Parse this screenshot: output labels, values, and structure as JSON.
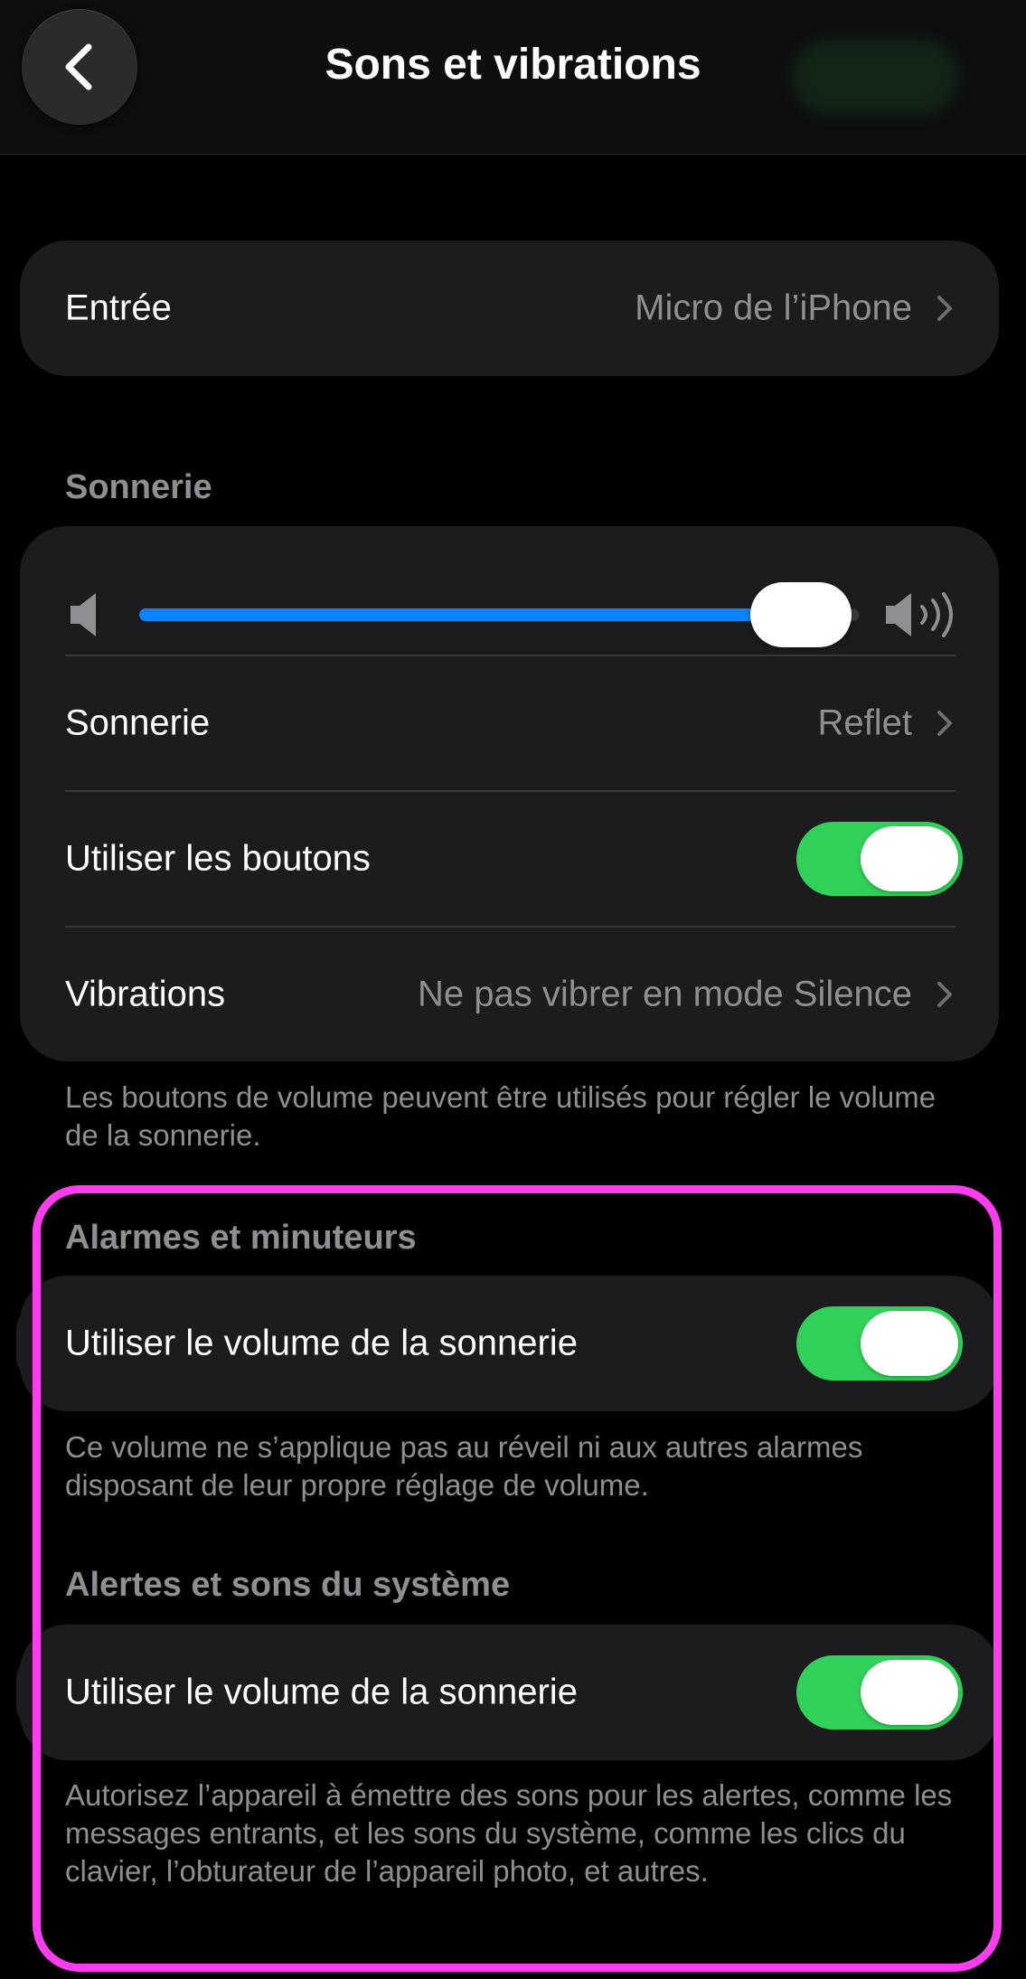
{
  "nav": {
    "title": "Sons et vibrations",
    "back_icon": "chevron-left-icon"
  },
  "input_group": {
    "label": "Entrée",
    "value": "Micro de l’iPhone"
  },
  "ringer_section": {
    "header": "Sonnerie",
    "volume_level": 0.92,
    "accent_color": "#0a84ff",
    "ringtone_label": "Sonnerie",
    "ringtone_value": "Reflet",
    "buttons_label": "Utiliser les boutons",
    "buttons_on": true,
    "vibrations_label": "Vibrations",
    "vibrations_value": "Ne pas vibrer en mode Silence",
    "footer": "Les boutons de volume peuvent être utilisés pour régler le volume de la sonnerie."
  },
  "alarms_section": {
    "header": "Alarmes et minuteurs",
    "toggle_label": "Utiliser le volume de la sonnerie",
    "toggle_on": true,
    "footer": "Ce volume ne s’applique pas au réveil ni aux autres alarmes disposant de leur propre réglage de volume."
  },
  "system_section": {
    "header": "Alertes et sons du système",
    "toggle_label": "Utiliser le volume de la sonnerie",
    "toggle_on": true,
    "footer": "Autorisez l’appareil à émettre des sons pour les alertes, comme les messages entrants, et les sons du système, comme les clics du clavier, l’obturateur de l’appareil photo, et autres."
  },
  "colors": {
    "toggle_on": "#30d158",
    "highlight": "#ff3cf0"
  }
}
